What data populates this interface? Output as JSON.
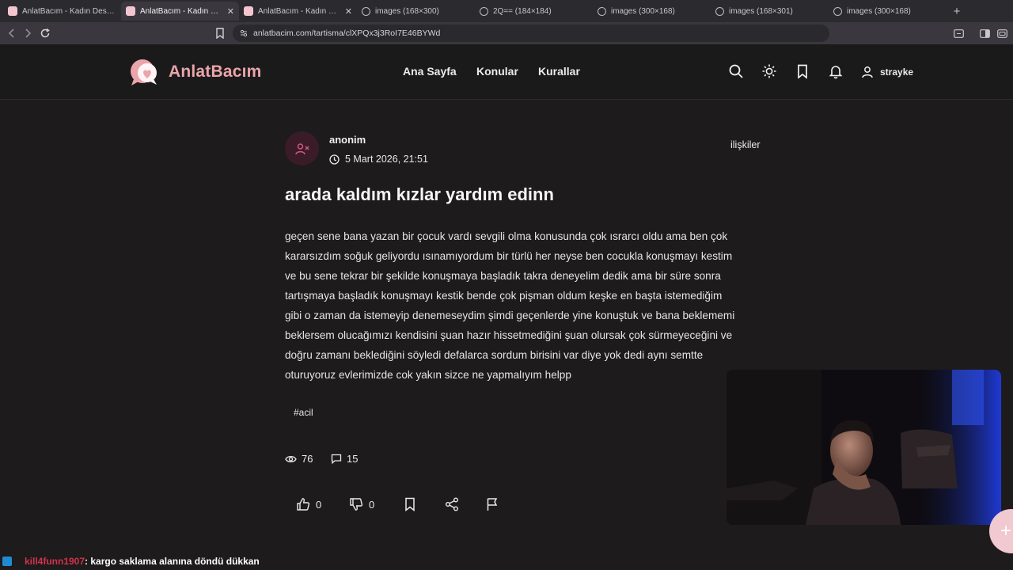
{
  "browser": {
    "tabs": [
      {
        "title": "AnlatBacım - Kadın Destek Platformu",
        "icon": "site-favicon",
        "active": false
      },
      {
        "title": "AnlatBacım - Kadın Destek",
        "icon": "site-favicon",
        "active": true
      },
      {
        "title": "AnlatBacım - Kadın Destek",
        "icon": "site-favicon",
        "active": false
      },
      {
        "title": "images (168×300)",
        "icon": "globe-icon",
        "active": false
      },
      {
        "title": "2Q== (184×184)",
        "icon": "globe-icon",
        "active": false
      },
      {
        "title": "images (300×168)",
        "icon": "globe-icon",
        "active": false
      },
      {
        "title": "images (168×301)",
        "icon": "globe-icon",
        "active": false
      },
      {
        "title": "images (300×168)",
        "icon": "globe-icon",
        "active": false
      }
    ],
    "new_tab": "+",
    "url": "anlatbacim.com/tartisma/clXPQx3j3RoI7E46BYWd"
  },
  "site": {
    "logo_text": "AnlatBacım",
    "nav": [
      "Ana Sayfa",
      "Konular",
      "Kurallar"
    ],
    "username": "strayke",
    "accent_color": "#eaa5aa"
  },
  "post": {
    "author": "anonim",
    "date": "5 Mart 2026, 21:51",
    "category": "ilişkiler",
    "title": "arada kaldım kızlar yardım edinn",
    "body_lines": [
      "geçen sene bana yazan bir çocuk vardı sevgili olma konusunda çok ısrarcı oldu ama ben çok",
      "kararsızdım soğuk geliyordu ısınamıyordum bir türlü her neyse ben cocukla konuşmayı kestim",
      "ve bu sene tekrar bir şekilde konuşmaya başladık takra deneyelim dedik ama bir süre sonra",
      "tartışmaya başladık konuşmayı kestik bende çok pişman oldum keşke en başta istemediğim",
      "gibi o zaman da istemeyip denemeseydim şimdi geçenlerde yine konuştuk ve bana beklememi",
      "beklersem olucağımızı kendisini şuan hazır hissetmediğini şuan olursak çok sürmeyeceğini ve",
      "doğru zamanı beklediğini söyledi defalarca sordum birisini var diye yok dedi aynı semtte",
      "oturuyoruz evlerimizde cok yakın sizce ne yapmalıyım helpp"
    ],
    "tag": "#acil",
    "views": "76",
    "comments": "15",
    "likes": "0",
    "dislikes": "0"
  },
  "chat": {
    "user": "kill4funn1907",
    "message": ": kargo saklama alanına döndü dükkan"
  }
}
